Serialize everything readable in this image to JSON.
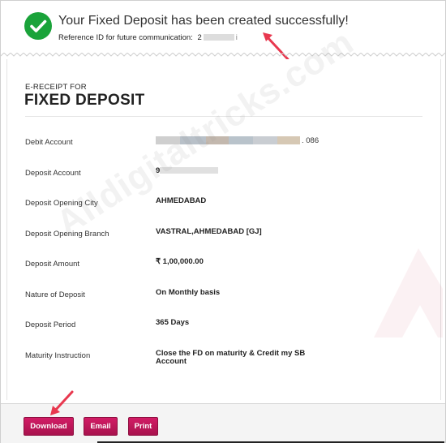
{
  "header": {
    "title": "Your Fixed Deposit has been created successfully!",
    "reference_label": "Reference ID for future communication:",
    "reference_visible_prefix": "2",
    "reference_visible_suffix": "i"
  },
  "receipt": {
    "subtitle": "E-RECEIPT FOR",
    "title": "FIXED DEPOSIT",
    "rows": [
      {
        "label": "Debit Account",
        "value": "",
        "value_suffix": ". 086",
        "masked": true
      },
      {
        "label": "Deposit Account",
        "value": "9",
        "masked_account": true
      },
      {
        "label": "Deposit Opening City",
        "value": "AHMEDABAD"
      },
      {
        "label": "Deposit Opening Branch",
        "value": "VASTRAL,AHMEDABAD [GJ]"
      },
      {
        "label": "Deposit Amount",
        "value": "₹ 1,00,000.00"
      },
      {
        "label": "Nature of Deposit",
        "value": "On Monthly basis"
      },
      {
        "label": "Deposit Period",
        "value": "365 Days"
      },
      {
        "label": "Maturity Instruction",
        "value": "Close the FD on maturity & Credit my SB Account"
      }
    ]
  },
  "watermark": {
    "text": "Alldigitaltricks.com"
  },
  "footer": {
    "download_label": "Download",
    "email_label": "Email",
    "print_label": "Print"
  },
  "colors": {
    "success_green": "#1aa33a",
    "button_pink": "#c2185b",
    "arrow_red": "#e8384f"
  },
  "icons": {
    "success": "checkmark-circle-icon",
    "annotation": "red-arrow-icon"
  }
}
